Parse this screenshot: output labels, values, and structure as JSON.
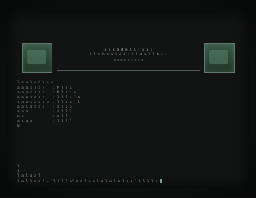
{
  "banner": {
    "line1": "a l  k a d e l  l l a a l",
    "line2": "l l s  h a  a l d  d s i l  d a  l l  h a s",
    "line3": "a a a a  a a a a a"
  },
  "info": {
    "header": "l a a l a h  a a a",
    "rows": [
      {
        "key": "a a a l l  a l",
        "value": "M l d a"
      },
      {
        "key": "a a a l l a a l",
        "value": "M l a i n"
      },
      {
        "key": "a a a l a l l",
        "value": "l l l  c l a"
      },
      {
        "key": "l a a l a a a a l",
        "value": "l l a a  l l"
      },
      {
        "key": "a a l  a a a a l",
        "value": "a l a a"
      },
      {
        "key": "a a a",
        "value": "a l l  l"
      },
      {
        "key": "a l",
        "value": "a l l"
      },
      {
        "key": "a l a a",
        "value": "l l l l"
      }
    ],
    "cursor": "0"
  },
  "prompt": {
    "line1": "l",
    "line2": "l",
    "line3": "l a l a a l",
    "line4": "l a l l a a l  =  \"l l l l a\"  a a  l a a l a l a l a l a a  l l l l l  ;"
  }
}
